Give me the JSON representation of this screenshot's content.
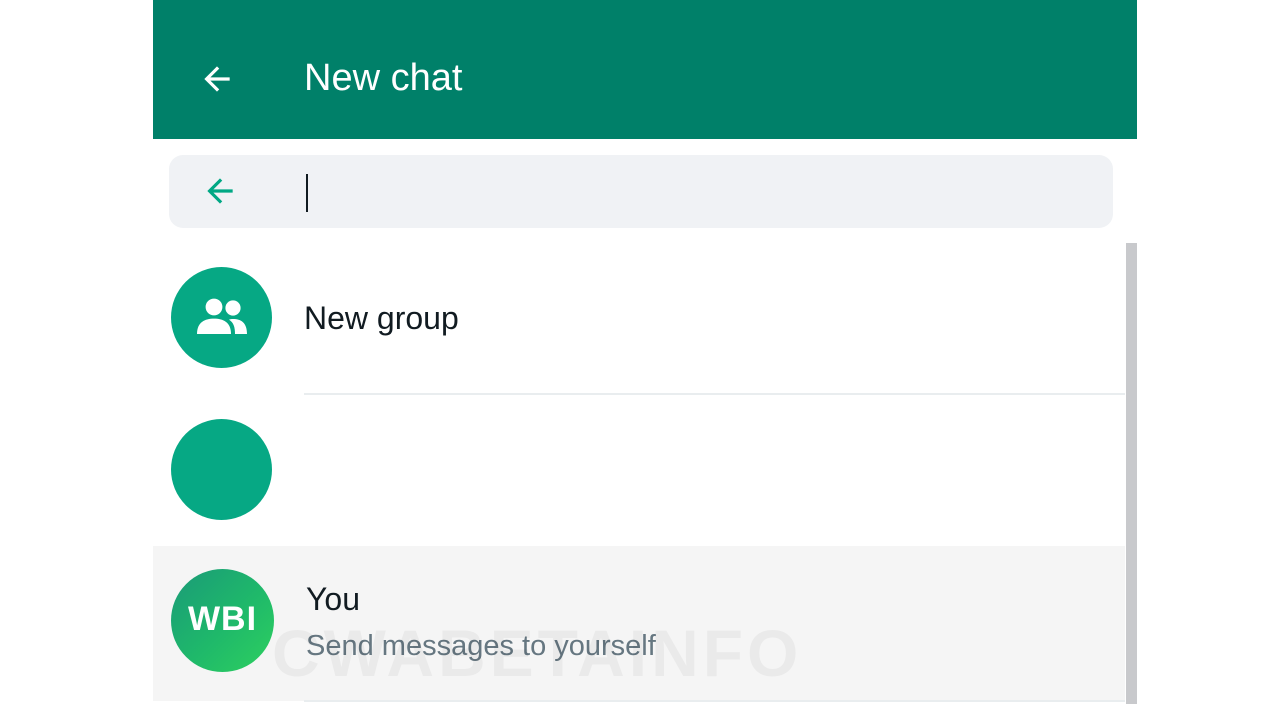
{
  "header": {
    "title": "New chat",
    "back_icon": "arrow-left-icon"
  },
  "search": {
    "value": "",
    "placeholder": "",
    "back_icon": "arrow-left-icon"
  },
  "list": [
    {
      "title": "New group",
      "icon": "group-icon",
      "subtitle": ""
    },
    {
      "title": "",
      "icon": "",
      "subtitle": ""
    },
    {
      "title": "You",
      "avatar_text": "WBI",
      "subtitle": "Send messages to yourself"
    }
  ],
  "watermark": "CWABETAINFO",
  "colors": {
    "header": "#008069",
    "accent": "#06a884",
    "search_bg": "#f0f2f5",
    "selected_row": "#f5f5f5",
    "subtitle": "#667781"
  }
}
